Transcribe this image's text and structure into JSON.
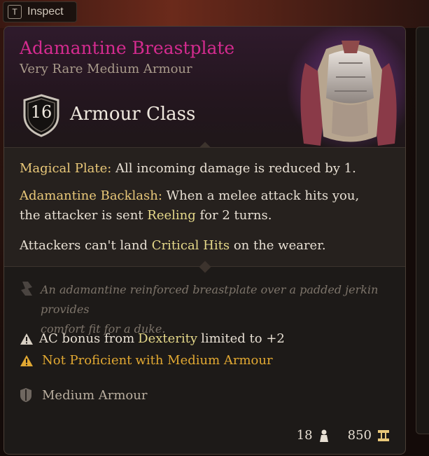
{
  "inspect": {
    "key": "T",
    "label": "Inspect"
  },
  "item": {
    "name": "Adamantine Breastplate",
    "rarity": "Very Rare Medium Armour",
    "armour_class": {
      "value": "16",
      "label": "Armour Class"
    },
    "properties": [
      {
        "name": "Magical Plate:",
        "text": "All incoming damage is reduced by 1."
      },
      {
        "name": "Adamantine Backlash:",
        "text_1": "When a melee attack hits you,",
        "text_2": "the attacker is sent",
        "keyword": "Reeling",
        "text_3": "for 2 turns."
      },
      {
        "text_1": "Attackers can't land",
        "keyword": "Critical Hits",
        "text_2": "on the wearer."
      }
    ],
    "flavor_1": "An adamantine reinforced breastplate over a padded jerkin provides",
    "flavor_2": "comfort fit for a duke.",
    "dex_limit": {
      "prefix": "AC bonus from",
      "keyword": "Dexterity",
      "suffix": "limited to +2"
    },
    "proficiency": {
      "prefix": "Not Proficient",
      "suffix": "with Medium Armour"
    },
    "category": "Medium Armour",
    "weight": "18",
    "value": "850"
  },
  "colors": {
    "name": "#d42b8f",
    "keyword": "#e6d98a",
    "bold": "#e9c879",
    "warning": "#e1a832"
  },
  "icons": [
    "shield-icon",
    "flavor-icon",
    "warning-icon",
    "armour-category-icon",
    "weight-icon",
    "gold-icon"
  ]
}
